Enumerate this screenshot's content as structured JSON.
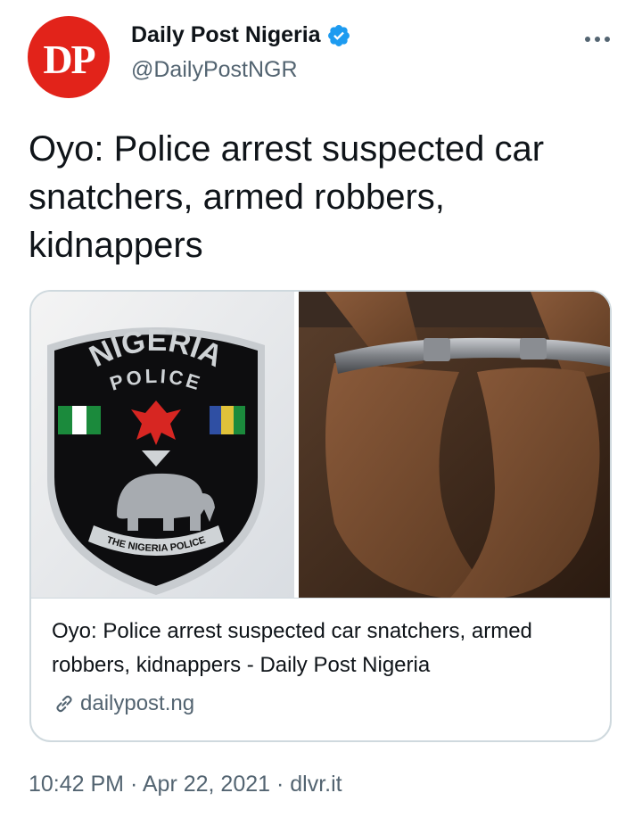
{
  "author": {
    "avatar_text": "DP",
    "name": "Daily Post Nigeria",
    "handle": "@DailyPostNGR",
    "verified_icon": "verified-badge-icon",
    "brand_color": "#e2231a"
  },
  "more_icon": "more-horizontal-icon",
  "tweet": {
    "text": "Oyo: Police arrest suspected car snatchers, armed robbers, kidnappers"
  },
  "card": {
    "badge_top_text": "NIGERIA",
    "badge_sub_text": "POLICE",
    "badge_ribbon_text": "THE NIGERIA POLICE",
    "title": "Oyo: Police arrest suspected car snatchers, armed robbers, kidnappers - Daily Post Nigeria",
    "link_icon": "link-icon",
    "domain": "dailypost.ng"
  },
  "meta": {
    "time": "10:42 PM",
    "separator": "·",
    "date": "Apr 22, 2021",
    "source": "dlvr.it"
  },
  "colors": {
    "text_primary": "#0f1419",
    "text_secondary": "#536471",
    "verified": "#1d9bf0",
    "border": "#cfd9de"
  }
}
